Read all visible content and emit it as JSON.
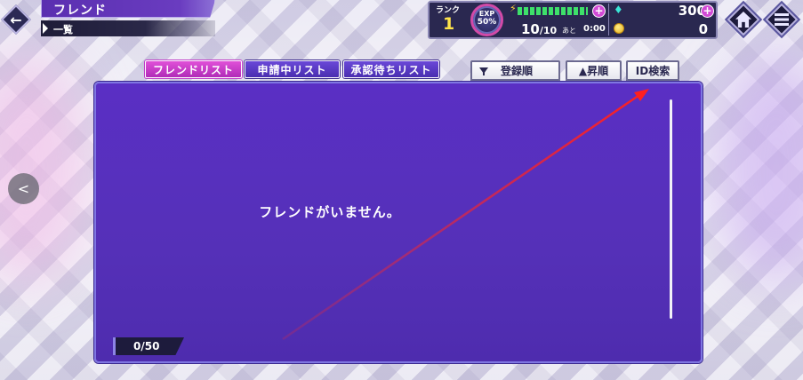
{
  "header": {
    "title": "フレンド",
    "subtitle": "一覧"
  },
  "status": {
    "rank_label": "ランク",
    "rank_value": "1",
    "exp_label": "EXP",
    "exp_value": "50%",
    "stamina_current": "10",
    "stamina_max": "/10",
    "recover_label": "あと",
    "recover_time": "0:00",
    "gems": "300",
    "coins": "0"
  },
  "tabs": [
    {
      "label": "フレンドリスト",
      "active": true
    },
    {
      "label": "申請中リスト",
      "active": false
    },
    {
      "label": "承認待ちリスト",
      "active": false
    }
  ],
  "sort": {
    "order_label": "登録順",
    "direction_label": "▲昇順",
    "id_search_label": "ID検索"
  },
  "main": {
    "empty_message": "フレンドがいません。",
    "count": "0/50"
  },
  "icons": {
    "back": "←",
    "side_prev": "<",
    "plus": "+",
    "bolt": "⚡",
    "gem": "♦"
  },
  "colors": {
    "panel": "#5a2fc4",
    "tab_active": "#d040d0",
    "tab_inactive": "#5a3cc8",
    "annotation_arrow": "#ff2020"
  }
}
